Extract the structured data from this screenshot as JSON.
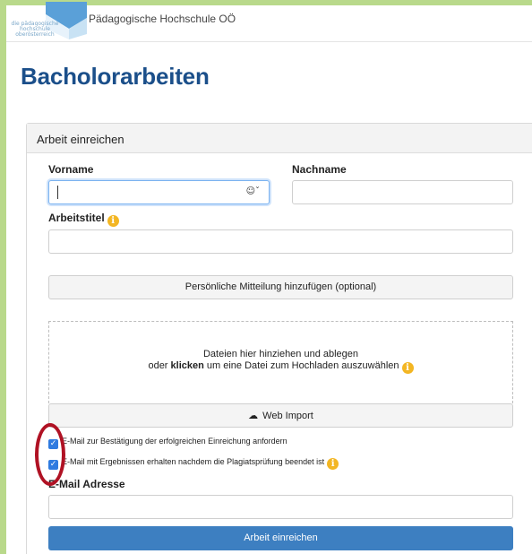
{
  "header": {
    "logo_text": "die pädagogische hochschule oberösterreich",
    "school_name": "Pädagogische Hochschule OÖ"
  },
  "page_title": "Bacholorarbeiten",
  "card": {
    "title": "Arbeit einreichen",
    "first_name_label": "Vorname",
    "first_name_value": "",
    "last_name_label": "Nachname",
    "last_name_value": "",
    "work_title_label": "Arbeitstitel",
    "work_title_value": "",
    "personal_message_button": "Persönliche Mitteilung hinzufügen (optional)",
    "dropzone_line1": "Dateien hier hinziehen und ablegen",
    "dropzone_line2_prefix": "oder ",
    "dropzone_line2_bold": "klicken",
    "dropzone_line2_suffix": " um eine Datei zum Hochladen auszuwählen",
    "web_import_label": "Web Import",
    "checkbox_confirm_label": "E-Mail zur Bestätigung der erfolgreichen Einreichung anfordern",
    "checkbox_confirm_checked": true,
    "checkbox_results_label": "E-Mail mit Ergebnissen erhalten nachdem die Plagiatsprüfung beendet ist",
    "checkbox_results_checked": true,
    "email_label": "E-Mail Adresse",
    "email_value": "",
    "submit_label": "Arbeit einreichen"
  },
  "icons": {
    "info": "info-icon",
    "cloud": "cloud-icon",
    "autofill": "person-autofill-icon"
  },
  "colors": {
    "frame": "#b9d98b",
    "title": "#1b4f8a",
    "submit": "#3d7fc1",
    "info": "#f3b623",
    "highlight_ellipse": "#b01224"
  }
}
